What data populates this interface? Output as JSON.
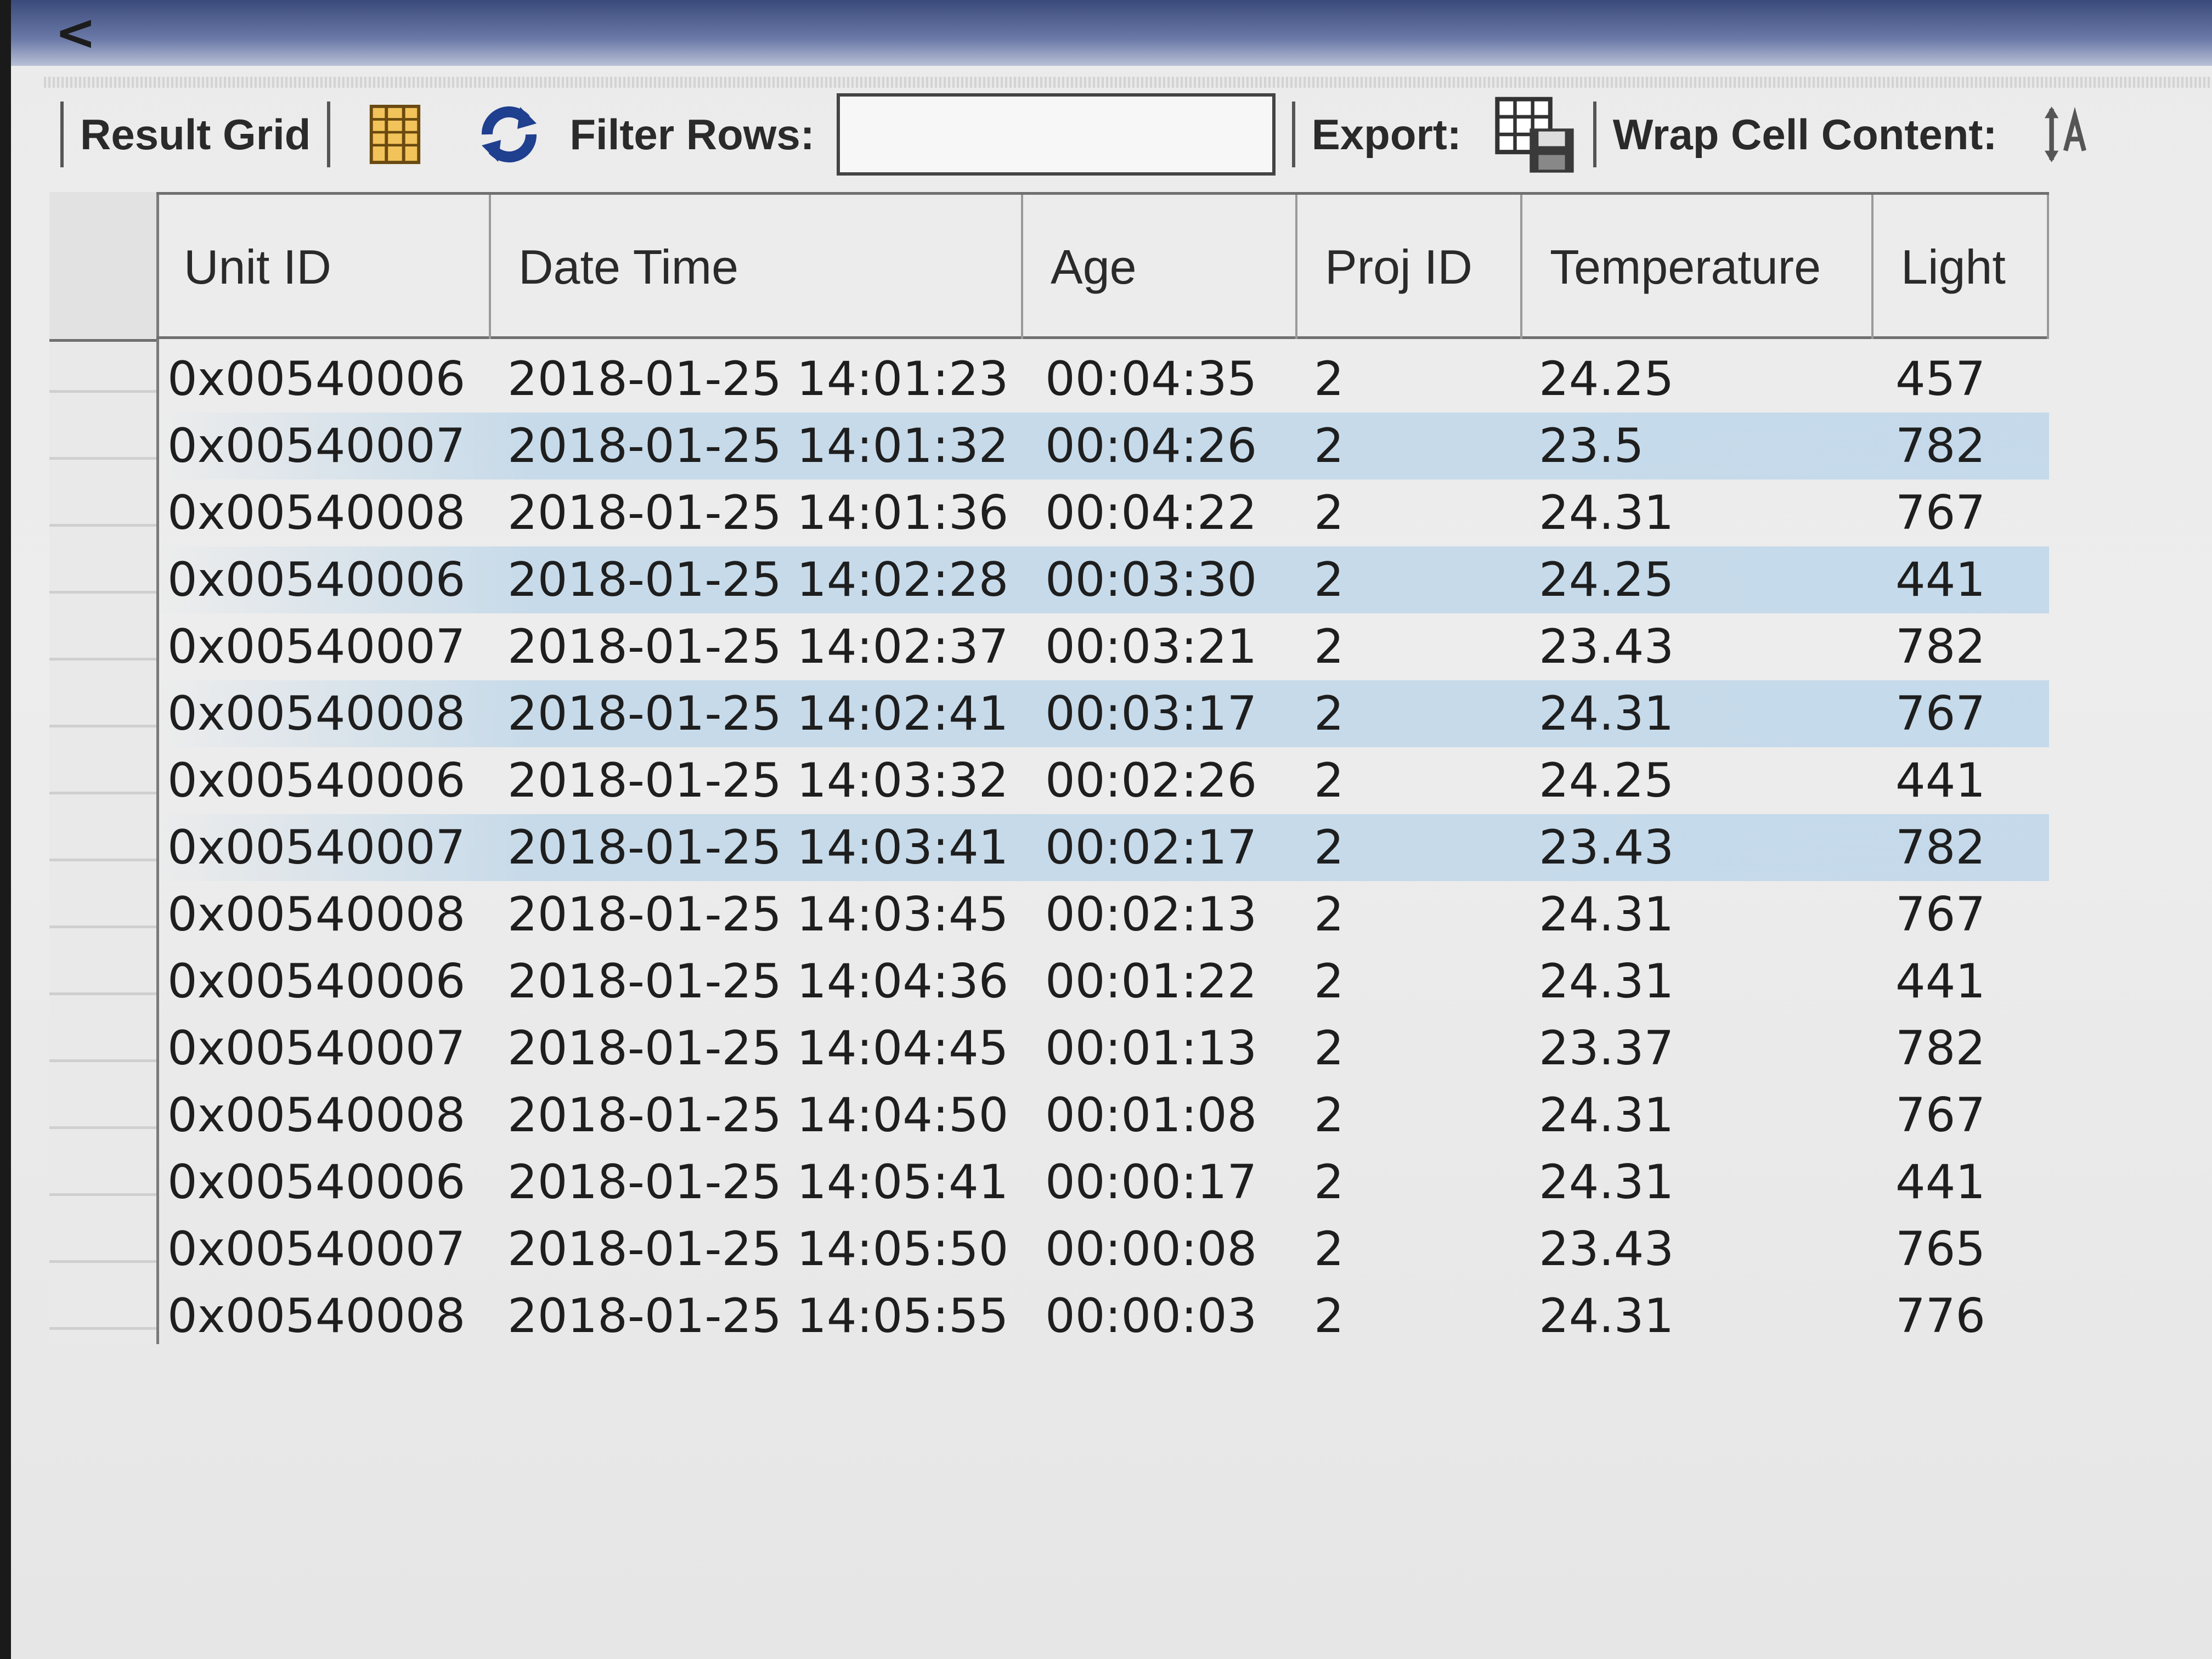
{
  "nav": {
    "back_label": "<"
  },
  "toolbar": {
    "result_grid_label": "Result Grid",
    "filter_label": "Filter Rows:",
    "filter_value": "",
    "export_label": "Export:",
    "wrap_label": "Wrap Cell Content:",
    "icons": [
      "grid-layout-icon",
      "refresh-icon",
      "export-icon",
      "wrap-text-icon"
    ]
  },
  "table": {
    "columns": [
      "Unit ID",
      "Date Time",
      "Age",
      "Proj ID",
      "Temperature",
      "Light"
    ],
    "rows": [
      [
        "0x00540006",
        "2018-01-25 14:01:23",
        "00:04:35",
        "2",
        "24.25",
        "457"
      ],
      [
        "0x00540007",
        "2018-01-25 14:01:32",
        "00:04:26",
        "2",
        "23.5",
        "782"
      ],
      [
        "0x00540008",
        "2018-01-25 14:01:36",
        "00:04:22",
        "2",
        "24.31",
        "767"
      ],
      [
        "0x00540006",
        "2018-01-25 14:02:28",
        "00:03:30",
        "2",
        "24.25",
        "441"
      ],
      [
        "0x00540007",
        "2018-01-25 14:02:37",
        "00:03:21",
        "2",
        "23.43",
        "782"
      ],
      [
        "0x00540008",
        "2018-01-25 14:02:41",
        "00:03:17",
        "2",
        "24.31",
        "767"
      ],
      [
        "0x00540006",
        "2018-01-25 14:03:32",
        "00:02:26",
        "2",
        "24.25",
        "441"
      ],
      [
        "0x00540007",
        "2018-01-25 14:03:41",
        "00:02:17",
        "2",
        "23.43",
        "782"
      ],
      [
        "0x00540008",
        "2018-01-25 14:03:45",
        "00:02:13",
        "2",
        "24.31",
        "767"
      ],
      [
        "0x00540006",
        "2018-01-25 14:04:36",
        "00:01:22",
        "2",
        "24.31",
        "441"
      ],
      [
        "0x00540007",
        "2018-01-25 14:04:45",
        "00:01:13",
        "2",
        "23.37",
        "782"
      ],
      [
        "0x00540008",
        "2018-01-25 14:04:50",
        "00:01:08",
        "2",
        "24.31",
        "767"
      ],
      [
        "0x00540006",
        "2018-01-25 14:05:41",
        "00:00:17",
        "2",
        "24.31",
        "441"
      ],
      [
        "0x00540007",
        "2018-01-25 14:05:50",
        "00:00:08",
        "2",
        "23.43",
        "765"
      ],
      [
        "0x00540008",
        "2018-01-25 14:05:55",
        "00:00:03",
        "2",
        "24.31",
        "776"
      ]
    ],
    "highlighted_rows": [
      1,
      3,
      5,
      7
    ]
  },
  "colors": {
    "highlight": "#bdd6ea",
    "refresh_icon": "#1f3f8f",
    "grid_icon": "#d89a2a"
  }
}
